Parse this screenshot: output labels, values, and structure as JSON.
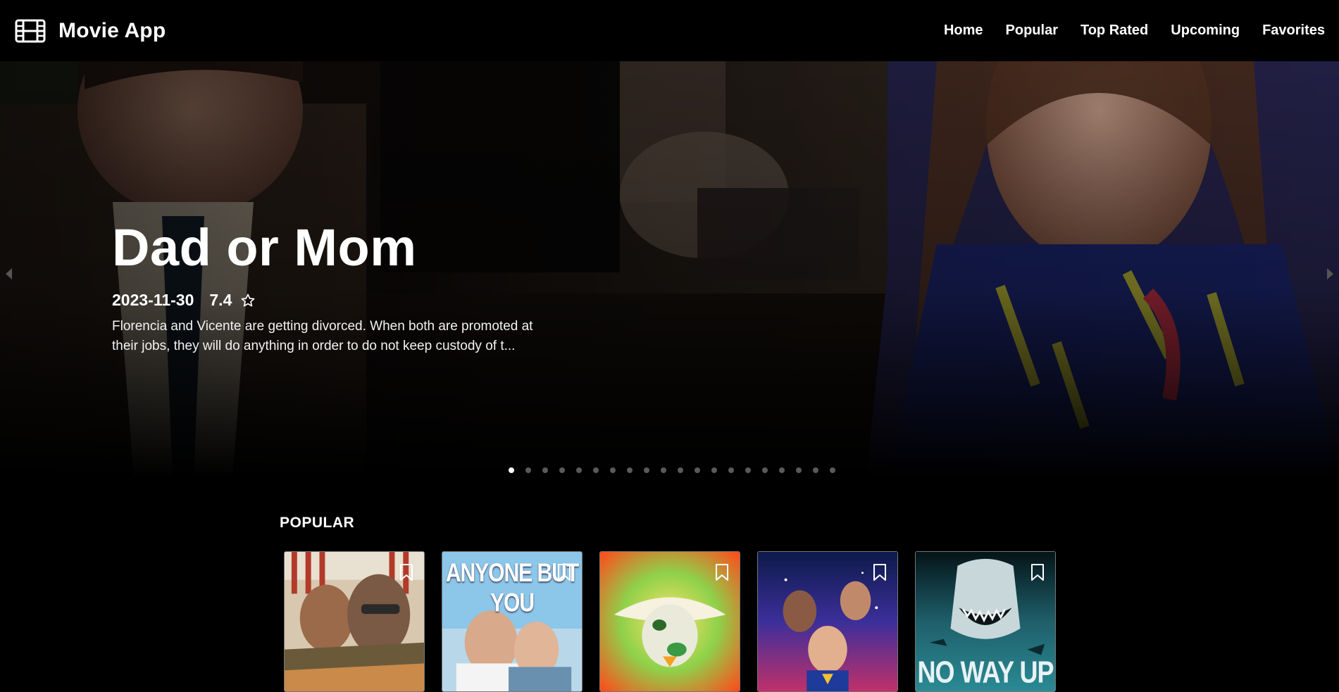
{
  "app": {
    "title": "Movie App",
    "logo_icon": "film-icon"
  },
  "nav": {
    "items": [
      {
        "label": "Home"
      },
      {
        "label": "Popular"
      },
      {
        "label": "Top Rated"
      },
      {
        "label": "Upcoming"
      },
      {
        "label": "Favorites"
      }
    ]
  },
  "hero": {
    "title": "Dad or Mom",
    "release_date": "2023-11-30",
    "rating": "7.4",
    "rating_icon": "star-outline-icon",
    "overview": "Florencia and Vicente are getting divorced. When both are promoted at their jobs, they will do anything in order to do not keep custody of t...",
    "slide_count": 20,
    "active_slide": 1
  },
  "popular": {
    "title": "POPULAR",
    "cards": [
      {
        "poster_text": "",
        "bookmark_icon": "bookmark-icon",
        "accent": "#c9a36a"
      },
      {
        "poster_text": "ANYONE BUT YOU",
        "bookmark_icon": "bookmark-icon",
        "accent": "#8cc6e8"
      },
      {
        "poster_text": "",
        "bookmark_icon": "bookmark-icon",
        "accent": "#ff6a1f"
      },
      {
        "poster_text": "",
        "bookmark_icon": "bookmark-icon",
        "accent": "#3b3fa8"
      },
      {
        "poster_text": "NO WAY UP",
        "bookmark_icon": "bookmark-icon",
        "accent": "#1f5f6a"
      }
    ]
  },
  "colors": {
    "background": "#000000",
    "text": "#ffffff",
    "dot_inactive": "#5a5a5a"
  }
}
